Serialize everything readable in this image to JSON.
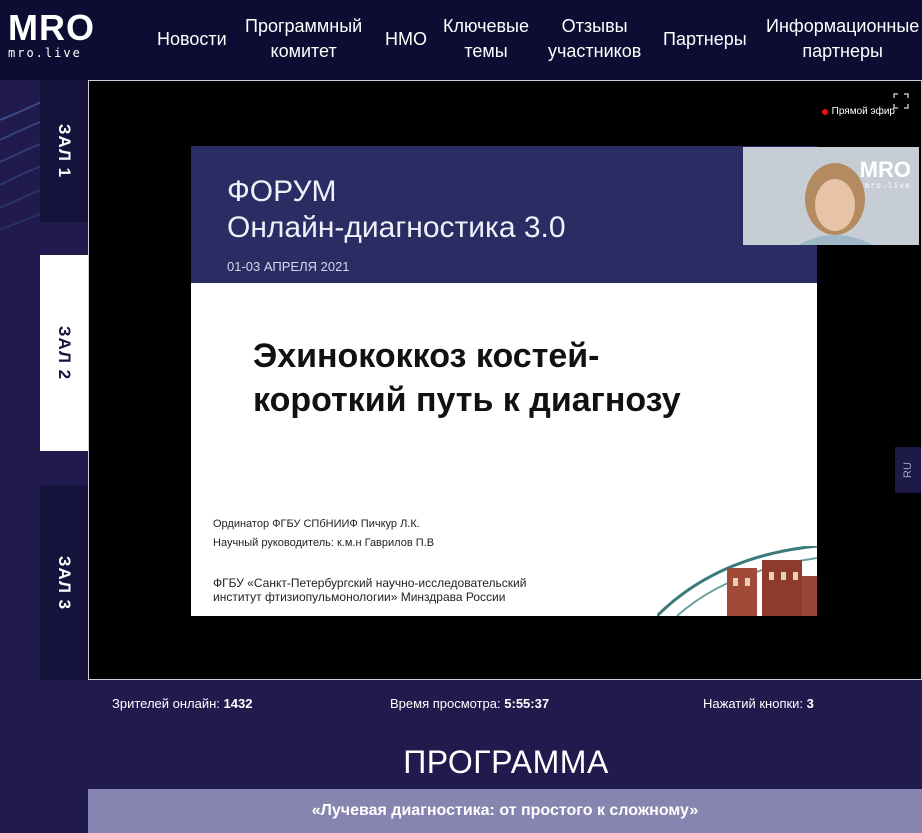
{
  "header": {
    "logo": {
      "mark": "MRO",
      "sub": "mro.live"
    },
    "nav": [
      {
        "label": "Новости"
      },
      {
        "label": "Программный\nкомитет"
      },
      {
        "label": "НМО"
      },
      {
        "label": "Ключевые\nтемы"
      },
      {
        "label": "Отзывы\nучастников"
      },
      {
        "label": "Партнеры"
      },
      {
        "label": "Информационные\nпартнеры"
      }
    ]
  },
  "halls": [
    {
      "label": "ЗАЛ 1",
      "active": false
    },
    {
      "label": "ЗАЛ 2",
      "active": true
    },
    {
      "label": "ЗАЛ 3",
      "active": false
    }
  ],
  "player": {
    "live_label": "Прямой эфир",
    "lang": "RU",
    "webcam_logo": {
      "mark": "MRO",
      "sub": "mro.live"
    },
    "slide": {
      "forum_label": "ФОРУМ",
      "forum_title": "Онлайн-диагностика 3.0",
      "dates": "01-03 АПРЕЛЯ 2021",
      "heading": "Эхинококкоз костей-\nкороткий путь к диагнозу",
      "author": "Ординатор ФГБУ СПбНИИФ Пичкур Л.К.",
      "advisor": "Научный руководитель: к.м.н Гаврилов П.В",
      "institution": "ФГБУ «Санкт-Петербургский научно-исследовательский\nинститут фтизиопульмонологии» Минздрава России"
    }
  },
  "stats": {
    "viewers_label": "Зрителей онлайн:",
    "viewers_value": "1432",
    "watch_label": "Время просмотра:",
    "watch_value": "5:55:37",
    "clicks_label": "Нажатий кнопки:",
    "clicks_value": "3"
  },
  "program": {
    "title": "ПРОГРАММА",
    "session": "«Лучевая диагностика: от простого к сложному»"
  },
  "colors": {
    "page_bg": "#201a4d",
    "header_bg": "#0d0d33",
    "hall_tab_bg": "#15123b",
    "program_bar": "#8784b0",
    "slide_banner": "#2a2d63",
    "live_dot": "#e11111"
  }
}
